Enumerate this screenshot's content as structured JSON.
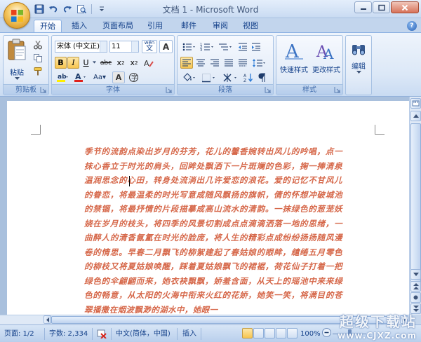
{
  "window": {
    "title": "文档 1 - Microsoft Word"
  },
  "tabs": [
    "开始",
    "插入",
    "页面布局",
    "引用",
    "邮件",
    "审阅",
    "视图"
  ],
  "ribbon": {
    "clipboard": {
      "label": "剪贴板",
      "paste": "粘贴"
    },
    "font": {
      "label": "字体",
      "font_name": "宋体 (中文正)",
      "font_size": "11",
      "wen": "wén"
    },
    "paragraph": {
      "label": "段落"
    },
    "styles": {
      "label": "样式",
      "quick_styles": "快速样式",
      "change_styles": "更改样式"
    },
    "editing": {
      "label": "编辑"
    }
  },
  "document": {
    "text": "季节的流韵点染出岁月的芬芳，花儿的馨香婉转出风儿的吟唱，点一抹心香立于时光的肩头，回眸处飘洒下一片斑斓的色彩，掬一捧清泉温润思念的心田，转身处流淌出几许爱恋的浪花。爱的记忆不甘风儿的眷恋，将最温柔的时光写意成随风飘扬的旗帜，倩的怀想冲破城池的禁锢，将最抒情的片段描摹成高山流水的清韵。一抹绿色的葱茏妖娆在岁月的枝头，将四季的风景切割成点点滴滴洒落一地的思绪，一曲醉人的清香氤氲在时光的脸庞，将人生的精彩点成纷纷扬扬随风漫卷的情思。早春二月飘飞的柳絮建起了春姑娘的眼眸，缱绻五月零色的柳枝又将夏姑娘唤醒，踩着夏姑娘飘飞的裙裾，荷花仙子打着一把绿色的伞翩翩而来，她衣袂飘飘，娇羞含面，从天上的瑶池中来来绿色的畅意，从太阳的火海中衔来火红的花娇，她笑一笑，将满目的苍翠播撒在烟波飘渺的湖水中，她眼一"
  },
  "status": {
    "page": "页面: 1/2",
    "words": "字数: 2,334",
    "language": "中文(简体，中国)",
    "mode": "插入",
    "zoom": "100%"
  },
  "watermark": {
    "main": "超级下载站",
    "sub": "www.CJXZ.com"
  },
  "colors": {
    "accent": "#15428b",
    "doc_text": "#d6684a"
  }
}
